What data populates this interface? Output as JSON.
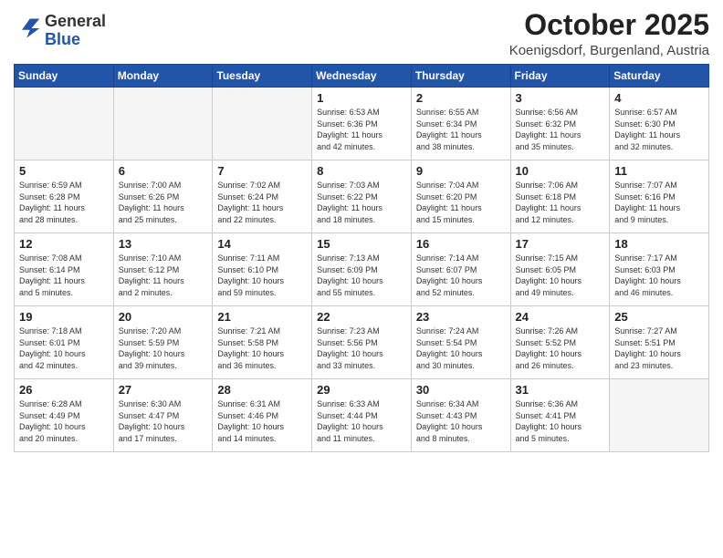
{
  "logo": {
    "general": "General",
    "blue": "Blue"
  },
  "title": "October 2025",
  "subtitle": "Koenigsdorf, Burgenland, Austria",
  "headers": [
    "Sunday",
    "Monday",
    "Tuesday",
    "Wednesday",
    "Thursday",
    "Friday",
    "Saturday"
  ],
  "weeks": [
    [
      {
        "day": "",
        "info": ""
      },
      {
        "day": "",
        "info": ""
      },
      {
        "day": "",
        "info": ""
      },
      {
        "day": "1",
        "info": "Sunrise: 6:53 AM\nSunset: 6:36 PM\nDaylight: 11 hours\nand 42 minutes."
      },
      {
        "day": "2",
        "info": "Sunrise: 6:55 AM\nSunset: 6:34 PM\nDaylight: 11 hours\nand 38 minutes."
      },
      {
        "day": "3",
        "info": "Sunrise: 6:56 AM\nSunset: 6:32 PM\nDaylight: 11 hours\nand 35 minutes."
      },
      {
        "day": "4",
        "info": "Sunrise: 6:57 AM\nSunset: 6:30 PM\nDaylight: 11 hours\nand 32 minutes."
      }
    ],
    [
      {
        "day": "5",
        "info": "Sunrise: 6:59 AM\nSunset: 6:28 PM\nDaylight: 11 hours\nand 28 minutes."
      },
      {
        "day": "6",
        "info": "Sunrise: 7:00 AM\nSunset: 6:26 PM\nDaylight: 11 hours\nand 25 minutes."
      },
      {
        "day": "7",
        "info": "Sunrise: 7:02 AM\nSunset: 6:24 PM\nDaylight: 11 hours\nand 22 minutes."
      },
      {
        "day": "8",
        "info": "Sunrise: 7:03 AM\nSunset: 6:22 PM\nDaylight: 11 hours\nand 18 minutes."
      },
      {
        "day": "9",
        "info": "Sunrise: 7:04 AM\nSunset: 6:20 PM\nDaylight: 11 hours\nand 15 minutes."
      },
      {
        "day": "10",
        "info": "Sunrise: 7:06 AM\nSunset: 6:18 PM\nDaylight: 11 hours\nand 12 minutes."
      },
      {
        "day": "11",
        "info": "Sunrise: 7:07 AM\nSunset: 6:16 PM\nDaylight: 11 hours\nand 9 minutes."
      }
    ],
    [
      {
        "day": "12",
        "info": "Sunrise: 7:08 AM\nSunset: 6:14 PM\nDaylight: 11 hours\nand 5 minutes."
      },
      {
        "day": "13",
        "info": "Sunrise: 7:10 AM\nSunset: 6:12 PM\nDaylight: 11 hours\nand 2 minutes."
      },
      {
        "day": "14",
        "info": "Sunrise: 7:11 AM\nSunset: 6:10 PM\nDaylight: 10 hours\nand 59 minutes."
      },
      {
        "day": "15",
        "info": "Sunrise: 7:13 AM\nSunset: 6:09 PM\nDaylight: 10 hours\nand 55 minutes."
      },
      {
        "day": "16",
        "info": "Sunrise: 7:14 AM\nSunset: 6:07 PM\nDaylight: 10 hours\nand 52 minutes."
      },
      {
        "day": "17",
        "info": "Sunrise: 7:15 AM\nSunset: 6:05 PM\nDaylight: 10 hours\nand 49 minutes."
      },
      {
        "day": "18",
        "info": "Sunrise: 7:17 AM\nSunset: 6:03 PM\nDaylight: 10 hours\nand 46 minutes."
      }
    ],
    [
      {
        "day": "19",
        "info": "Sunrise: 7:18 AM\nSunset: 6:01 PM\nDaylight: 10 hours\nand 42 minutes."
      },
      {
        "day": "20",
        "info": "Sunrise: 7:20 AM\nSunset: 5:59 PM\nDaylight: 10 hours\nand 39 minutes."
      },
      {
        "day": "21",
        "info": "Sunrise: 7:21 AM\nSunset: 5:58 PM\nDaylight: 10 hours\nand 36 minutes."
      },
      {
        "day": "22",
        "info": "Sunrise: 7:23 AM\nSunset: 5:56 PM\nDaylight: 10 hours\nand 33 minutes."
      },
      {
        "day": "23",
        "info": "Sunrise: 7:24 AM\nSunset: 5:54 PM\nDaylight: 10 hours\nand 30 minutes."
      },
      {
        "day": "24",
        "info": "Sunrise: 7:26 AM\nSunset: 5:52 PM\nDaylight: 10 hours\nand 26 minutes."
      },
      {
        "day": "25",
        "info": "Sunrise: 7:27 AM\nSunset: 5:51 PM\nDaylight: 10 hours\nand 23 minutes."
      }
    ],
    [
      {
        "day": "26",
        "info": "Sunrise: 6:28 AM\nSunset: 4:49 PM\nDaylight: 10 hours\nand 20 minutes."
      },
      {
        "day": "27",
        "info": "Sunrise: 6:30 AM\nSunset: 4:47 PM\nDaylight: 10 hours\nand 17 minutes."
      },
      {
        "day": "28",
        "info": "Sunrise: 6:31 AM\nSunset: 4:46 PM\nDaylight: 10 hours\nand 14 minutes."
      },
      {
        "day": "29",
        "info": "Sunrise: 6:33 AM\nSunset: 4:44 PM\nDaylight: 10 hours\nand 11 minutes."
      },
      {
        "day": "30",
        "info": "Sunrise: 6:34 AM\nSunset: 4:43 PM\nDaylight: 10 hours\nand 8 minutes."
      },
      {
        "day": "31",
        "info": "Sunrise: 6:36 AM\nSunset: 4:41 PM\nDaylight: 10 hours\nand 5 minutes."
      },
      {
        "day": "",
        "info": ""
      }
    ]
  ]
}
